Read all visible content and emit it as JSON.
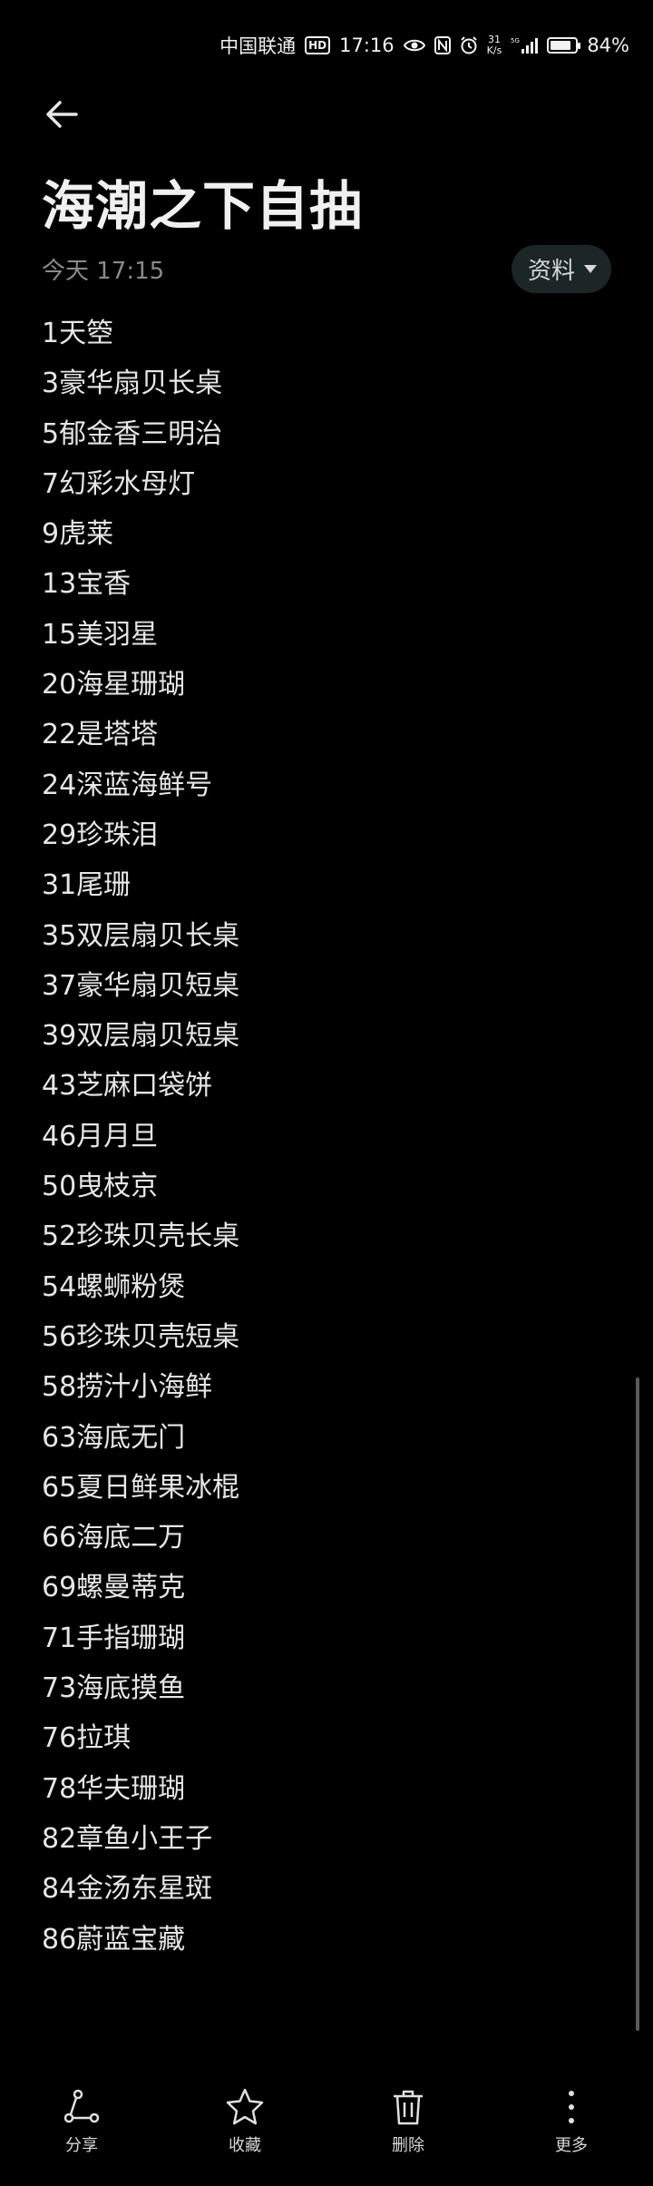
{
  "status_bar": {
    "carrier": "中国联通",
    "hd_badge": "HD",
    "time": "17:16",
    "net_speed_value": "31",
    "net_speed_unit": "K/s",
    "battery_percent": "84%",
    "battery_level": 0.84
  },
  "header": {
    "title": "海潮之下自抽",
    "date": "今天 17:15",
    "folder_label": "资料"
  },
  "note": {
    "lines": [
      "1天箜",
      "3豪华扇贝长桌",
      "5郁金香三明治",
      "7幻彩水母灯",
      "9虎莱",
      "13宝香",
      "15美羽星",
      "20海星珊瑚",
      "22是塔塔",
      "24深蓝海鲜号",
      "29珍珠泪",
      "31尾珊",
      "35双层扇贝长桌",
      "37豪华扇贝短桌",
      "39双层扇贝短桌",
      "43芝麻口袋饼",
      "46月月旦",
      "50曳枝京",
      "52珍珠贝壳长桌",
      "54螺蛳粉煲",
      "56珍珠贝壳短桌",
      "58捞汁小海鲜",
      "63海底无门",
      "65夏日鲜果冰棍",
      "66海底二万",
      "69螺曼蒂克",
      "71手指珊瑚",
      "73海底摸鱼",
      "76拉琪",
      "78华夫珊瑚",
      "82章鱼小王子",
      "84金汤东星斑",
      "86蔚蓝宝藏"
    ]
  },
  "toolbar": {
    "share_label": "分享",
    "favorite_label": "收藏",
    "delete_label": "删除",
    "more_label": "更多"
  },
  "icons": {
    "back": "arrow-left-icon",
    "share": "share-icon",
    "favorite": "star-icon",
    "delete": "trash-icon",
    "more": "more-vertical-icon"
  }
}
